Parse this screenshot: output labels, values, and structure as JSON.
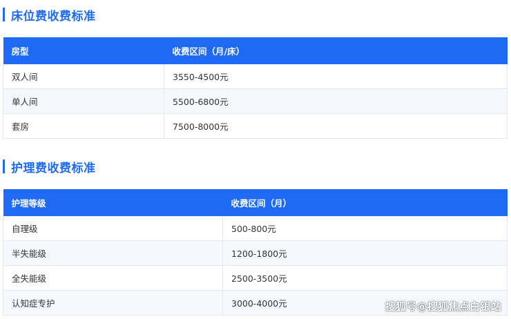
{
  "bed_section": {
    "title": "床位费收费标准",
    "headers": [
      "房型",
      "收费区间（月/床）"
    ],
    "rows": [
      [
        "双人间",
        "3550-4500元"
      ],
      [
        "单人间",
        "5500-6800元"
      ],
      [
        "套房",
        "7500-8000元"
      ]
    ]
  },
  "care_section": {
    "title": "护理费收费标准",
    "headers": [
      "护理等级",
      "收费区间（月）"
    ],
    "rows": [
      [
        "自理级",
        "500-800元"
      ],
      [
        "半失能级",
        "1200-1800元"
      ],
      [
        "全失能级",
        "2500-3500元"
      ],
      [
        "认知症专护",
        "3000-4000元"
      ]
    ]
  },
  "watermark": "搜狐号@搜狐焦点白银站",
  "colors": {
    "accent": "#1f6bf2",
    "header_bg": "#1e6af5",
    "alt_row_bg": "#f5f8fd"
  }
}
